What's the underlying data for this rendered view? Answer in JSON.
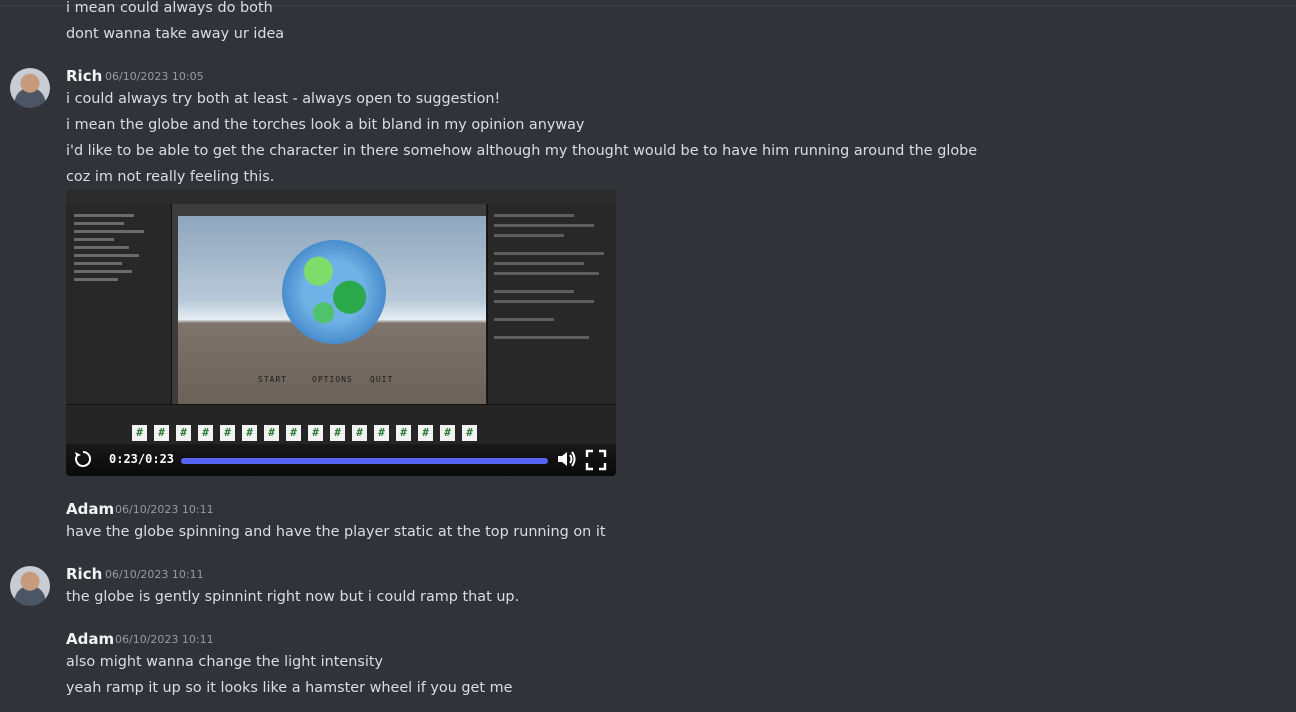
{
  "messages": [
    {
      "lines": [
        "i mean could always do both",
        "dont wanna take away ur idea"
      ]
    },
    {
      "author": "Rich",
      "timestamp": "06/10/2023 10:05",
      "lines": [
        "i could always try both at least - always open to suggestion!",
        "i mean the globe and the torches look a bit bland in my opinion anyway",
        "i'd like to be able to get the character in there somehow although my thought would be to have him running around the globe",
        "coz im not really feeling this."
      ]
    },
    {
      "author": "Adam",
      "timestamp": "06/10/2023 10:11",
      "lines": [
        "have the globe spinning and have the player static at the top running on it"
      ]
    },
    {
      "author": "Rich",
      "timestamp": "06/10/2023 10:11",
      "lines": [
        "the globe is gently spinnint right now but i could ramp that up."
      ]
    },
    {
      "author": "Adam",
      "timestamp": "06/10/2023 10:11",
      "lines": [
        "also might wanna change the light intensity",
        "yeah ramp it up so it looks like a hamster wheel if you get me"
      ]
    }
  ],
  "video": {
    "time": "0:23/0:23",
    "progress": 1.0,
    "menu_words": [
      "START",
      "OPTIONS",
      "QUIT"
    ],
    "asset_glyph": "#",
    "asset_count": 16,
    "icons": {
      "replay": "replay-icon",
      "volume": "volume-icon",
      "fullscreen": "fullscreen-icon"
    }
  },
  "colors": {
    "background": "#313338",
    "progress": "#5865f2"
  }
}
